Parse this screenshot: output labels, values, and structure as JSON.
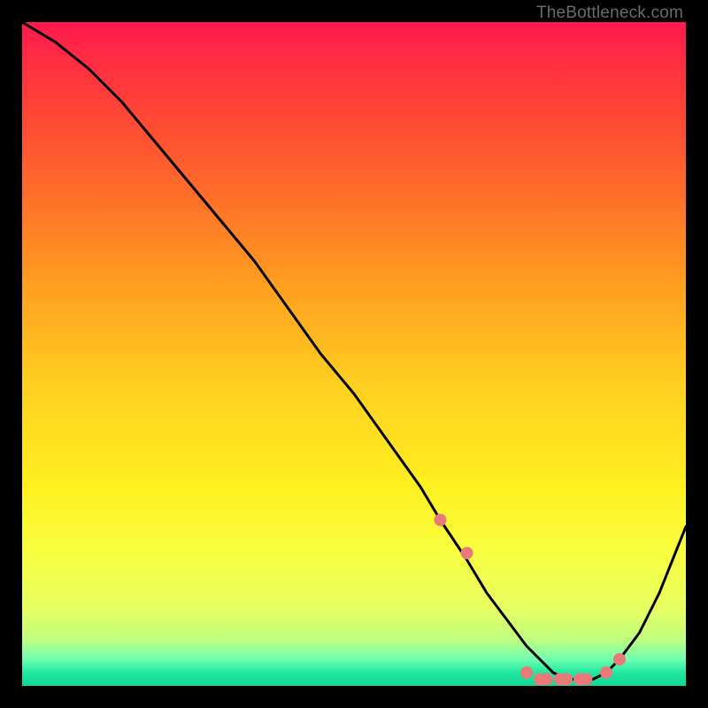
{
  "watermark": "TheBottleneck.com",
  "chart_data": {
    "type": "line",
    "title": "",
    "xlabel": "",
    "ylabel": "",
    "xlim": [
      0,
      100
    ],
    "ylim": [
      0,
      100
    ],
    "series": [
      {
        "name": "bottleneck-curve",
        "x": [
          0,
          5,
          10,
          15,
          20,
          25,
          30,
          35,
          40,
          45,
          50,
          55,
          60,
          63,
          67,
          70,
          73,
          76,
          78,
          80,
          82,
          84,
          86,
          88,
          90,
          93,
          96,
          100
        ],
        "y": [
          100,
          97,
          93,
          88,
          82,
          76,
          70,
          64,
          57,
          50,
          44,
          37,
          30,
          25,
          19,
          14,
          10,
          6,
          4,
          2,
          1,
          1,
          1,
          2,
          4,
          8,
          14,
          24
        ]
      }
    ],
    "markers": {
      "name": "highlight-points",
      "x": [
        63,
        67,
        76,
        78,
        79,
        81,
        82,
        84,
        85,
        88,
        90
      ],
      "y": [
        25,
        20,
        2,
        1,
        1,
        1,
        1,
        1,
        1,
        2,
        4
      ]
    },
    "background_gradient": {
      "top": "#ff1a4d",
      "bottom": "#10d890"
    },
    "curve_color": "#000000",
    "marker_color": "#e97a7a"
  }
}
